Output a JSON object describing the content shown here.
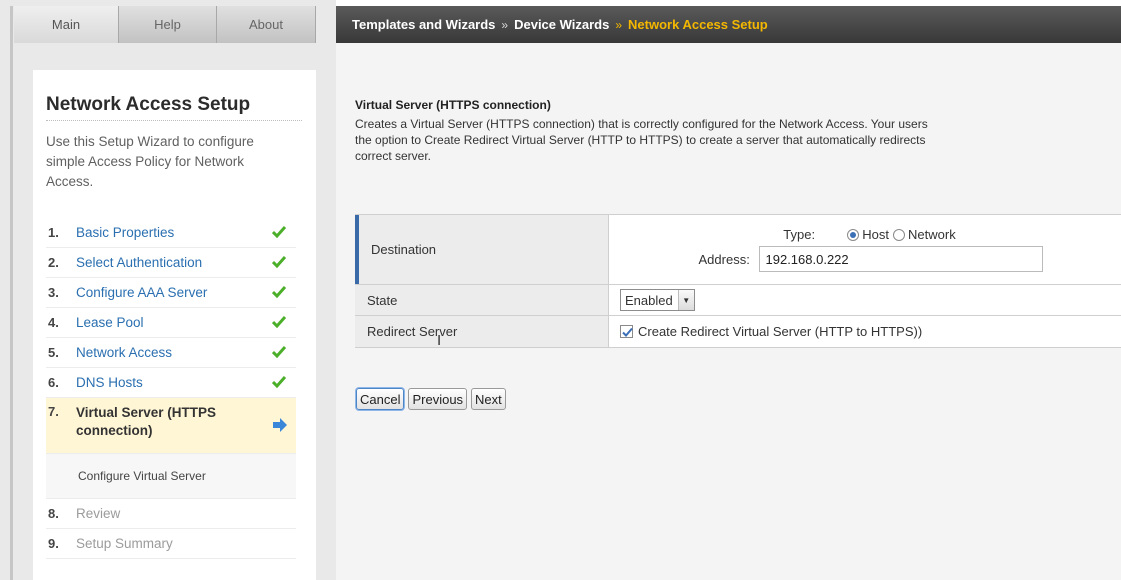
{
  "tabs": [
    {
      "label": "Main"
    },
    {
      "label": "Help"
    },
    {
      "label": "About"
    }
  ],
  "breadcrumb": {
    "items": [
      "Templates and Wizards",
      "Device Wizards"
    ],
    "separator": "»",
    "current": "Network Access Setup"
  },
  "sidebar": {
    "title": "Network Access Setup",
    "description": "Use this Setup Wizard to configure simple Access Policy for Network Access.",
    "steps": [
      {
        "num": "1.",
        "label": "Basic Properties",
        "status": "done"
      },
      {
        "num": "2.",
        "label": "Select Authentication",
        "status": "done"
      },
      {
        "num": "3.",
        "label": "Configure AAA Server",
        "status": "done"
      },
      {
        "num": "4.",
        "label": "Lease Pool",
        "status": "done"
      },
      {
        "num": "5.",
        "label": "Network Access",
        "status": "done"
      },
      {
        "num": "6.",
        "label": "DNS Hosts",
        "status": "done"
      },
      {
        "num": "7.",
        "label": "Virtual Server (HTTPS connection)",
        "status": "current",
        "sub": "Configure Virtual Server"
      },
      {
        "num": "8.",
        "label": "Review",
        "status": "pending"
      },
      {
        "num": "9.",
        "label": "Setup Summary",
        "status": "pending"
      }
    ]
  },
  "content": {
    "title": "Virtual Server (HTTPS connection)",
    "description_lines": [
      "Creates a Virtual Server (HTTPS connection) that is correctly configured for the Network Access. Your users",
      "the option to Create Redirect Virtual Server (HTTP to HTTPS) to create a server that automatically redirects",
      "correct server."
    ]
  },
  "form": {
    "destination": {
      "label": "Destination",
      "type_label": "Type:",
      "options": [
        "Host",
        "Network"
      ],
      "selected": "Host",
      "address_label": "Address:",
      "address_value": "192.168.0.222"
    },
    "state": {
      "label": "State",
      "value": "Enabled"
    },
    "redirect": {
      "label": "Redirect Server",
      "checkbox_label": "Create Redirect Virtual Server (HTTP to HTTPS))",
      "checked": true
    }
  },
  "buttons": {
    "cancel": "Cancel",
    "previous": "Previous",
    "next": "Next"
  },
  "colors": {
    "link": "#2a6fb0",
    "accent": "#f4b700",
    "check": "#4caf2a",
    "arrow": "#3a86d8",
    "current_step_bg": "#fff6d6"
  }
}
